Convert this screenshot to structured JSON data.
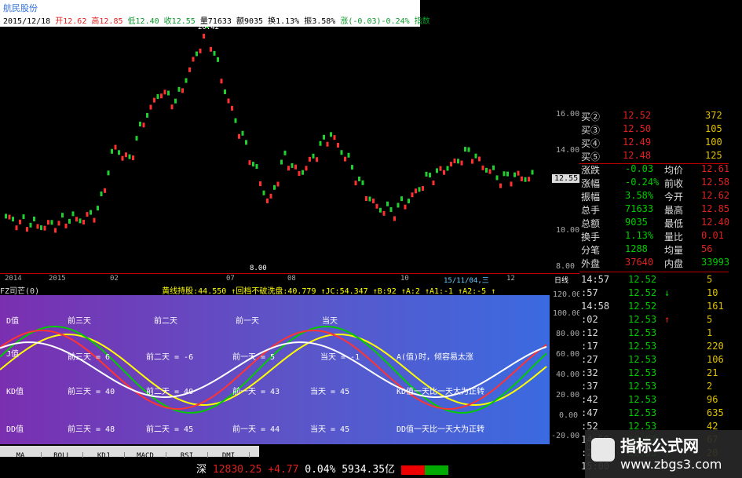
{
  "header": {
    "stock_name": "航民股份",
    "date": "2015/12/18",
    "open": "开12.62",
    "high": "高12.85",
    "low": "低12.40",
    "close": "收12.55",
    "volume": "量71633",
    "amount": "额9035",
    "turnover": "换1.13%",
    "amplitude": "振3.58%",
    "change": "涨(-0.03)-0.24%",
    "indicator_link": "指数"
  },
  "price_axis": [
    "16.00",
    "14.00",
    "12.55",
    "10.00",
    "8.00"
  ],
  "price_marks": {
    "high": "20.42",
    "low": "8.00"
  },
  "date_axis": [
    "2014",
    "2015",
    "02",
    "07",
    "08",
    "10",
    "15/11/04,三",
    "12",
    "日线"
  ],
  "indicator": {
    "title": "FZ司芒(0)",
    "extra": "黄线持股:44.550 ↑回档不破洗盘:40.779 ↑JC:54.347 ↑B:92 ↑A:2 ↑A1:-1 ↑A2:-5 ↑",
    "axis": [
      "120.00",
      "100.00",
      "80.00",
      "60.00",
      "40.00",
      "20.00",
      "0.00",
      "-20.00"
    ],
    "labels": [
      "K值",
      "前三天",
      "前二天",
      "前一天",
      "当天",
      "前三天 = 6",
      "前二天 = -6",
      "前一天 = 5",
      "当天 = -1",
      "A(值)时，倾容易太涨",
      "前三天 = 40",
      "前二天 = 40",
      "前一天 = 43",
      "当天 = 45",
      "KD值一天比一天大为正转",
      "前三天 = 48",
      "前二天 = 45",
      "前一天 = 44",
      "当天 = 45",
      "DD值一天比一天大为正转",
      "D值",
      "J值",
      "KD值",
      "DD值"
    ]
  },
  "tabs": [
    "MA",
    "BOLL",
    "KDJ",
    "MACD",
    "RSI",
    "DMI"
  ],
  "status": {
    "market": "深",
    "index": "12830.25",
    "change": "+4.77",
    "pct": "0.04%",
    "amount": "5934.35亿"
  },
  "quotes": {
    "bids": [
      {
        "label": "买②",
        "price": "12.52",
        "vol": "372"
      },
      {
        "label": "买③",
        "price": "12.50",
        "vol": "105"
      },
      {
        "label": "买④",
        "price": "12.49",
        "vol": "100"
      },
      {
        "label": "买⑤",
        "price": "12.48",
        "vol": "125"
      }
    ],
    "stats": [
      {
        "l1": "涨跌",
        "v1": "-0.03",
        "l2": "均价",
        "v2": "12.61"
      },
      {
        "l1": "涨幅",
        "v1": "-0.24%",
        "l2": "前收",
        "v2": "12.58"
      },
      {
        "l1": "振幅",
        "v1": "3.58%",
        "l2": "今开",
        "v2": "12.62"
      },
      {
        "l1": "总手",
        "v1": "71633",
        "l2": "最高",
        "v2": "12.85"
      },
      {
        "l1": "总额",
        "v1": "9035",
        "l2": "最低",
        "v2": "12.40"
      },
      {
        "l1": "换手",
        "v1": "1.13%",
        "l2": "量比",
        "v2": "0.01"
      },
      {
        "l1": "分笔",
        "v1": "1288",
        "l2": "均量",
        "v2": "56"
      },
      {
        "l1": "外盘",
        "v1": "37640",
        "l2": "内盘",
        "v2": "33993"
      }
    ],
    "ticks": [
      {
        "t": "14:57",
        "p": "12.52",
        "a": "",
        "v": "5"
      },
      {
        "t": ":57",
        "p": "12.52",
        "a": "↓",
        "v": "10"
      },
      {
        "t": "14:58",
        "p": "12.52",
        "a": "",
        "v": "161"
      },
      {
        "t": ":02",
        "p": "12.53",
        "a": "↑",
        "v": "5"
      },
      {
        "t": ":12",
        "p": "12.53",
        "a": "",
        "v": "1"
      },
      {
        "t": ":17",
        "p": "12.53",
        "a": "",
        "v": "220"
      },
      {
        "t": ":27",
        "p": "12.53",
        "a": "",
        "v": "106"
      },
      {
        "t": ":32",
        "p": "12.53",
        "a": "",
        "v": "21"
      },
      {
        "t": ":37",
        "p": "12.53",
        "a": "",
        "v": "2"
      },
      {
        "t": ":42",
        "p": "12.53",
        "a": "",
        "v": "96"
      },
      {
        "t": ":47",
        "p": "12.53",
        "a": "",
        "v": "635"
      },
      {
        "t": ":52",
        "p": "12.53",
        "a": "",
        "v": "42"
      },
      {
        "t": "14:59",
        "p": "12.54",
        "a": "↑",
        "v": "67"
      },
      {
        "t": ":22",
        "p": "12.53",
        "a": "↓",
        "v": "20"
      },
      {
        "t": "15:00",
        "p": "",
        "a": "",
        "v": ""
      }
    ]
  },
  "watermark": {
    "title": "指标公式网",
    "url": "www.zbgs3.com"
  }
}
